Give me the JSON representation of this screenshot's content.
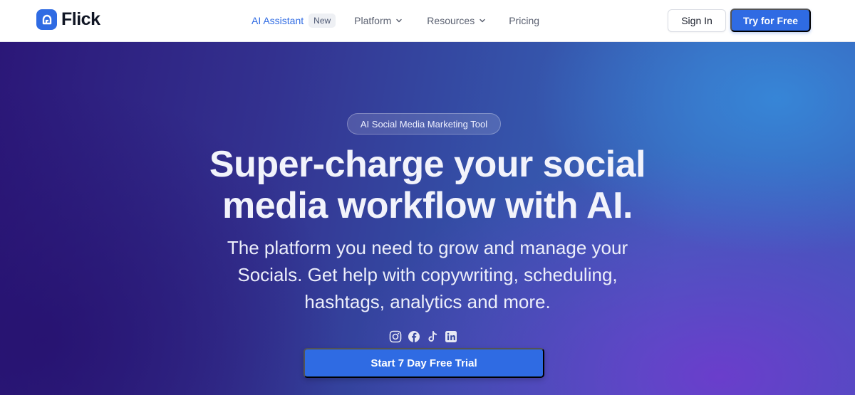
{
  "header": {
    "logo_text": "Flick",
    "nav": [
      {
        "label": "AI Assistant",
        "badge": "New",
        "icon": "none",
        "active": true
      },
      {
        "label": "Platform",
        "icon": "chevron-down-icon"
      },
      {
        "label": "Resources",
        "icon": "chevron-down-icon"
      },
      {
        "label": "Pricing",
        "icon": "none"
      }
    ],
    "signin_label": "Sign In",
    "try_label": "Try for Free"
  },
  "hero": {
    "pill": "AI Social Media Marketing Tool",
    "title_line1": "Super-charge your social",
    "title_line2": "media workflow with AI.",
    "subtitle_line1": "The platform you need to grow and manage your",
    "subtitle_line2": "Socials. Get help with copywriting, scheduling,",
    "subtitle_line3": "hashtags, analytics and more.",
    "social_icons": [
      "instagram-icon",
      "facebook-icon",
      "tiktok-icon",
      "linkedin-icon"
    ],
    "cta_label": "Start 7 Day Free Trial"
  },
  "colors": {
    "brand": "#2f6be3",
    "hero_start": "#2b1778",
    "hero_end": "#3a62b8",
    "title_text": "#f2f3fb"
  }
}
